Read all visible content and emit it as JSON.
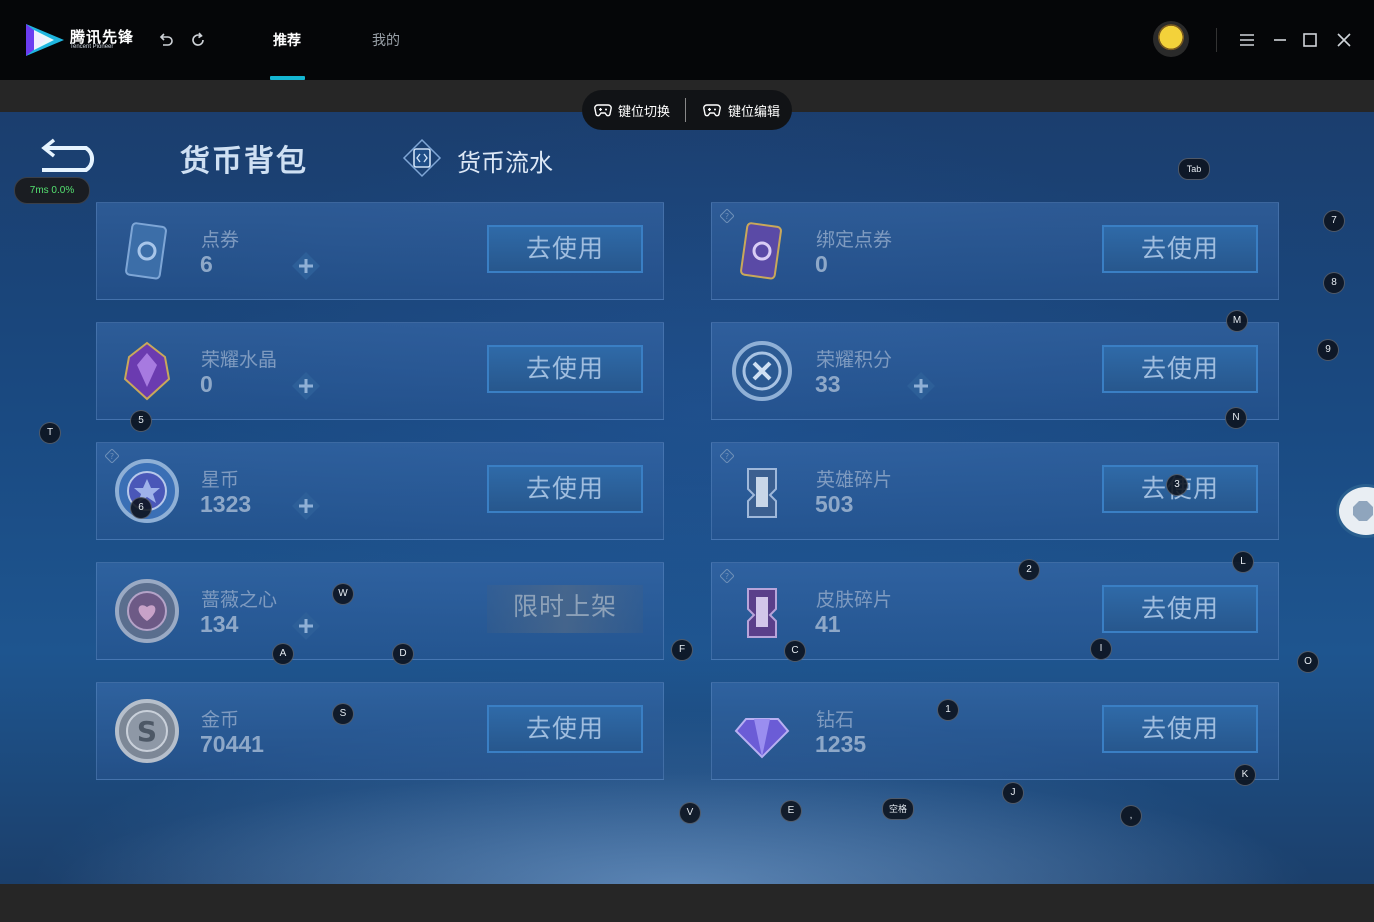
{
  "app": {
    "logo_text": "腾讯先锋",
    "logo_subtext": "Tencent Pioneer",
    "tabs": [
      {
        "label": "推荐",
        "active": true
      },
      {
        "label": "我的",
        "active": false
      }
    ],
    "accent_color": "#14b6d2"
  },
  "keybar": {
    "switch_label": "键位切换",
    "edit_label": "键位编辑"
  },
  "game": {
    "stats": "7ms  0.0%",
    "heading_active": "货币背包",
    "heading_other": "货币流水",
    "cards": [
      {
        "name": "点券",
        "value": "6",
        "button": "去使用",
        "icon": "ticket-card-icon",
        "plus": true
      },
      {
        "name": "绑定点券",
        "value": "0",
        "button": "去使用",
        "icon": "purple-ticket-card-icon",
        "plus": false
      },
      {
        "name": "荣耀水晶",
        "value": "0",
        "button": "去使用",
        "icon": "purple-crystal-icon",
        "plus": true
      },
      {
        "name": "荣耀积分",
        "value": "33",
        "button": "去使用",
        "icon": "honor-points-medal-icon",
        "plus": true
      },
      {
        "name": "星币",
        "value": "1323",
        "button": "去使用",
        "icon": "star-coin-icon",
        "plus": true
      },
      {
        "name": "英雄碎片",
        "value": "503",
        "button": "去使用",
        "icon": "hero-fragment-icon",
        "plus": false
      },
      {
        "name": "蔷薇之心",
        "value": "134",
        "button": "限时上架",
        "icon": "rose-heart-coin-icon",
        "plus": true,
        "disabled": true
      },
      {
        "name": "皮肤碎片",
        "value": "41",
        "button": "去使用",
        "icon": "skin-fragment-icon",
        "plus": false
      },
      {
        "name": "金币",
        "value": "70441",
        "button": "去使用",
        "icon": "gold-coin-icon",
        "plus": false
      },
      {
        "name": "钻石",
        "value": "1235",
        "button": "去使用",
        "icon": "diamond-icon",
        "plus": false
      }
    ]
  },
  "key_hints": [
    "Tab",
    "7",
    "8",
    "M",
    "9",
    "N",
    "T",
    "5",
    "6",
    "3",
    "L",
    "2",
    "W",
    "A",
    "D",
    "F",
    "C",
    "I",
    "O",
    "S",
    "1",
    "K",
    "J",
    "V",
    "E",
    "空格",
    ","
  ]
}
